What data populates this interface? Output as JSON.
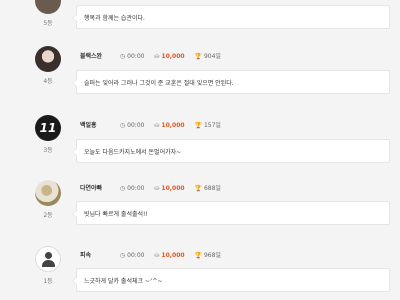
{
  "entries": [
    {
      "rank": "5등",
      "name": "",
      "time": "",
      "points": "",
      "days": "",
      "message": "행복과 함께는 습관이다."
    },
    {
      "rank": "4등",
      "name": "블랙스완",
      "time": "00:00",
      "points": "10,000",
      "days": "904일",
      "message": "슬퍼는 잊어라 그러나 그것이 준 교훈은 절대 잊으면 안된다."
    },
    {
      "rank": "3등",
      "name": "백일홍",
      "time": "00:00",
      "points": "10,000",
      "days": "157일",
      "message": "오늘도 다음드카지노에서 돈벌어가자~"
    },
    {
      "rank": "2등",
      "name": "다연아빠",
      "time": "00:00",
      "points": "10,000",
      "days": "688일",
      "message": "빗님다 빠르게 출석출석!!"
    },
    {
      "rank": "1등",
      "name": "피속",
      "time": "00:00",
      "points": "10,000",
      "days": "968일",
      "message": "느긋하게 달카 출석체크 ~ᐟ^~"
    }
  ],
  "icons": {
    "clock": "clock-icon",
    "points": "coin-icon",
    "trophy": "trophy-icon",
    "avatar_default": "user-icon"
  },
  "colors": {
    "accent": "#e0561f",
    "background": "#f4f4f4"
  },
  "avatar2_text": "11"
}
